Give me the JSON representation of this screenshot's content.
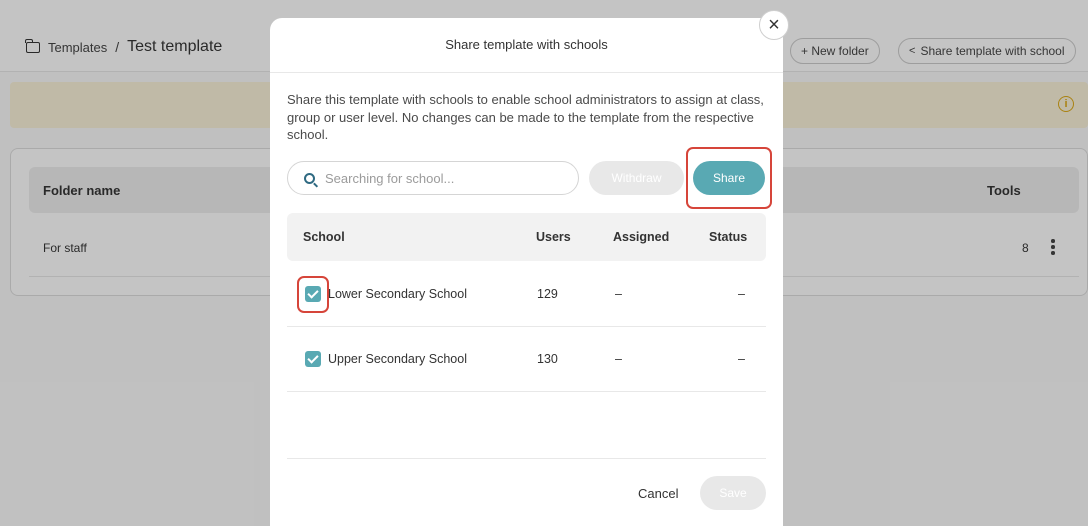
{
  "breadcrumb": {
    "root": "Templates",
    "separator": "/",
    "current": "Test template"
  },
  "header_buttons": {
    "new_folder": "+ New folder",
    "share_template": "Share template with school"
  },
  "table": {
    "col_folder": "Folder name",
    "col_tools": "Tools",
    "rows": [
      {
        "name": "For staff",
        "tools": "8"
      }
    ]
  },
  "modal": {
    "title": "Share template with schools",
    "close_glyph": "×",
    "description": "Share this template with schools to enable school administrators to assign at class, group or user level. No changes can be made to the template from the respective school.",
    "search_placeholder": "Searching for school...",
    "withdraw": "Withdraw",
    "share": "Share",
    "columns": {
      "school": "School",
      "users": "Users",
      "assigned": "Assigned",
      "status": "Status"
    },
    "schools": [
      {
        "name": "Lower Secondary School",
        "users": "129",
        "assigned": "–",
        "status": "–",
        "checked": true
      },
      {
        "name": "Upper Secondary School",
        "users": "130",
        "assigned": "–",
        "status": "–",
        "checked": true
      }
    ],
    "cancel": "Cancel",
    "save": "Save"
  },
  "colors": {
    "accent": "#59a9b3",
    "highlight": "#d6453a",
    "banner": "#faf1d6"
  },
  "icons": [
    "folder-icon",
    "share-icon",
    "info-icon",
    "search-icon",
    "close-icon",
    "checkbox-checked-icon",
    "kebab-menu-icon"
  ]
}
